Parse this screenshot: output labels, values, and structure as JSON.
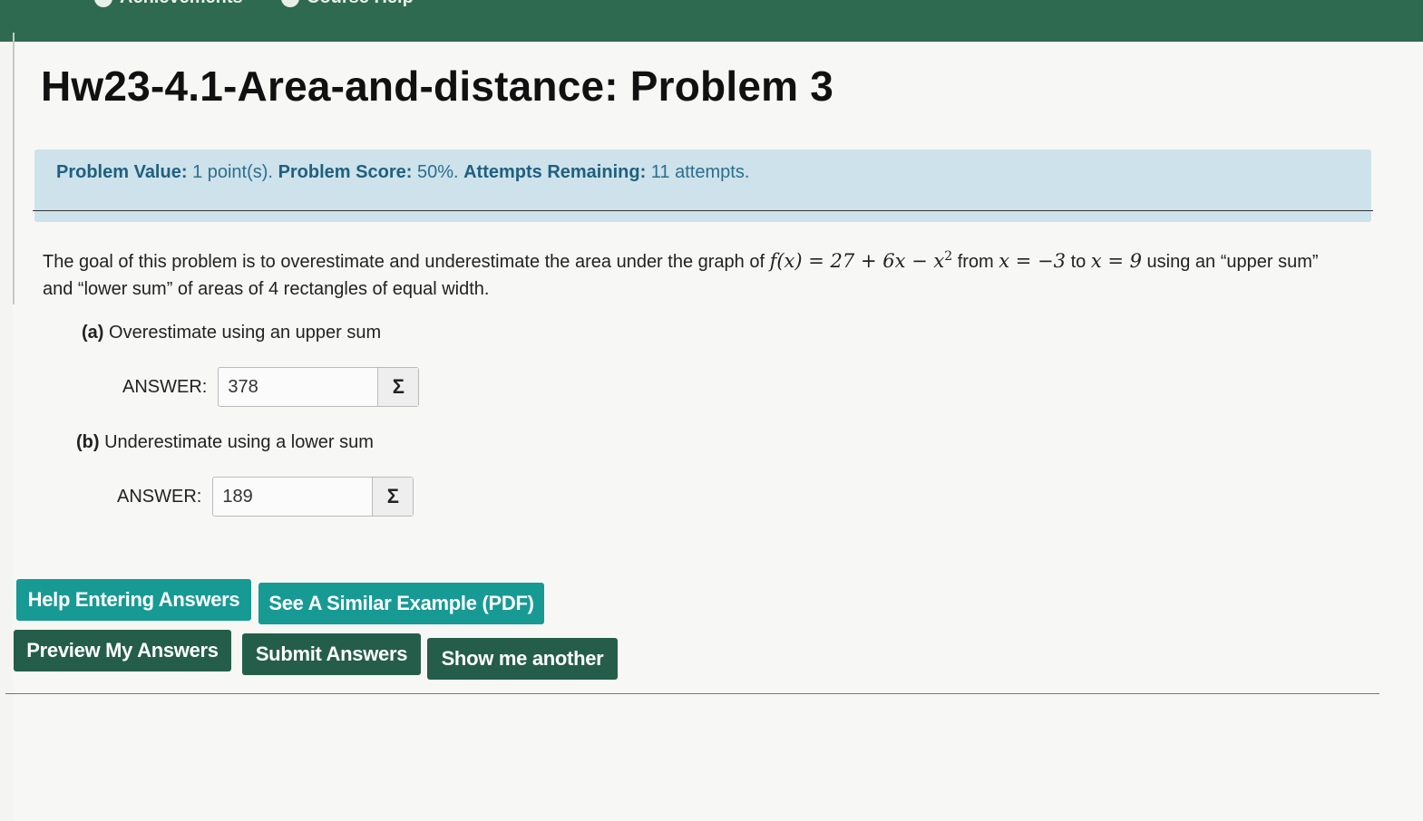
{
  "nav": {
    "achievements": "Achievements",
    "course_help": "Course Help"
  },
  "problem": {
    "title": "Hw23-4.1-Area-and-distance: Problem 3",
    "info": {
      "value_label": "Problem Value:",
      "value": "1 point(s).",
      "score_label": "Problem Score:",
      "score": "50%.",
      "attempts_label": "Attempts Remaining:",
      "attempts": "11 attempts."
    },
    "statement": {
      "intro": "The goal of this problem is to overestimate and underestimate the area under the graph of",
      "function": "f(x) = 27 + 6x − x",
      "exponent": "2",
      "from_word": "from",
      "lower": "x = −3",
      "to_word": "to",
      "upper": "x = 9",
      "tail": "using an “upper sum” and “lower sum” of areas of 4 rectangles of equal width."
    },
    "parts": [
      {
        "letter": "(a)",
        "text": "Overestimate using an upper sum",
        "answer_label": "ANSWER:",
        "answer": "378",
        "sigma": "Σ"
      },
      {
        "letter": "(b)",
        "text": "Underestimate using a lower sum",
        "answer_label": "ANSWER:",
        "answer": "189",
        "sigma": "Σ"
      }
    ]
  },
  "buttons": {
    "help_entering": "Help Entering Answers",
    "similar_example": "See A Similar Example (PDF)",
    "preview": "Preview My Answers",
    "submit": "Submit Answers",
    "show_another": "Show me another"
  },
  "colors": {
    "nav_bar": "#2e6a4f",
    "info_bg": "#cde2ea",
    "teal_button": "#179a94",
    "dark_button": "#245e4a"
  }
}
